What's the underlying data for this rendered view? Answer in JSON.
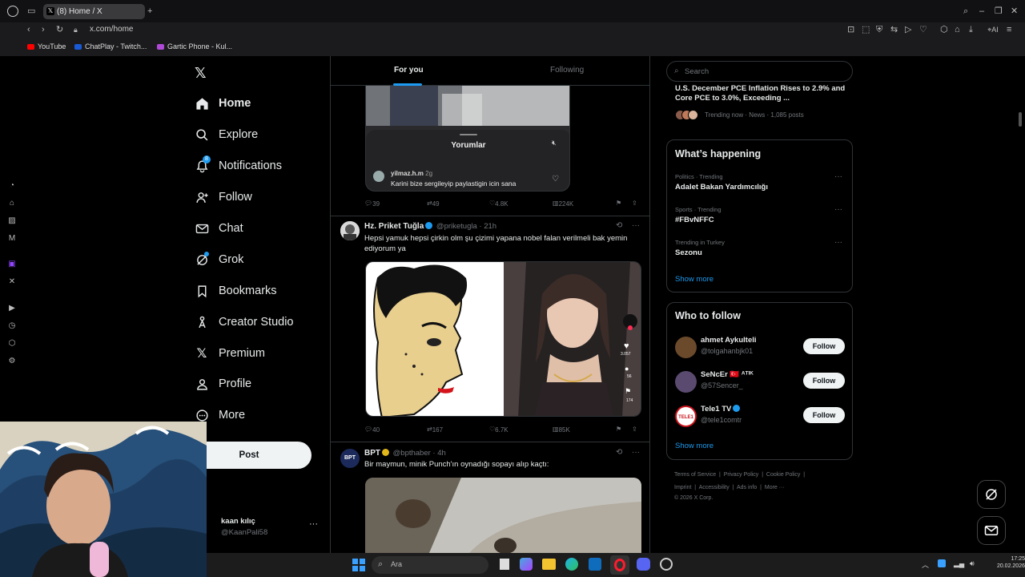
{
  "browser": {
    "tab_title": "(8) Home / X",
    "url": "x.com/home",
    "bookmarks": [
      {
        "label": "YouTube",
        "color": "#ff0000"
      },
      {
        "label": "ChatPlay - Twitch...",
        "color": "#1a5ad6"
      },
      {
        "label": "Gartic Phone - Kul...",
        "color": "#b04ad6"
      }
    ]
  },
  "nav": {
    "items": [
      {
        "label": "Home",
        "icon": "home-icon"
      },
      {
        "label": "Explore",
        "icon": "search-icon"
      },
      {
        "label": "Notifications",
        "icon": "bell-icon",
        "badge": "8"
      },
      {
        "label": "Follow",
        "icon": "person-plus-icon"
      },
      {
        "label": "Chat",
        "icon": "envelope-icon"
      },
      {
        "label": "Grok",
        "icon": "grok-icon"
      },
      {
        "label": "Bookmarks",
        "icon": "bookmark-icon"
      },
      {
        "label": "Creator Studio",
        "icon": "creator-icon"
      },
      {
        "label": "Premium",
        "icon": "x-icon"
      },
      {
        "label": "Profile",
        "icon": "person-icon"
      },
      {
        "label": "More",
        "icon": "more-circle-icon"
      }
    ],
    "post_label": "Post",
    "account": {
      "name": "kaan kılıç",
      "handle": "@KaanPali58"
    }
  },
  "feed": {
    "tabs": [
      "For you",
      "Following"
    ],
    "comments_overlay": {
      "title": "Yorumlar",
      "commenter": "yilmaz.h.m",
      "time": "2g",
      "text": "Karini bize sergileyip paylastigin icin sana"
    },
    "tweet1_actions": {
      "replies": "39",
      "reposts": "49",
      "likes": "4.8K",
      "views": "224K"
    },
    "tweet2": {
      "name": "Hz. Priket Tuğla",
      "handle": "@priketugla",
      "time": "21h",
      "text": "Hepsi yamuk hepsi çirkin olm şu çizimi yapana nobel falan verilmeli bak yemin ediyorum ya",
      "side_counts": [
        "3.057",
        "56",
        "174"
      ],
      "actions": {
        "replies": "40",
        "reposts": "167",
        "likes": "6.7K",
        "views": "85K"
      }
    },
    "tweet3": {
      "avatar_text": "BPT",
      "name": "BPT",
      "handle": "@bpthaber",
      "time": "4h",
      "text": "Bir maymun, minik Punch'ın oynadığı sopayı alıp kaçtı:"
    }
  },
  "sidebar": {
    "search_placeholder": "Search",
    "top_trend": {
      "title": "U.S. December PCE Inflation Rises to 2.9% and Core PCE to 3.0%, Exceeding ...",
      "meta": "Trending now · News · 1,085 posts"
    },
    "happening": {
      "title": "What’s happening",
      "trends": [
        {
          "meta": "Politics · Trending",
          "title": "Adalet Bakan Yardımcılığı"
        },
        {
          "meta": "Sports · Trending",
          "title": "#FBvNFFC"
        },
        {
          "meta": "Trending in Turkey",
          "title": "Sezonu"
        }
      ],
      "show_more": "Show more"
    },
    "who_to_follow": {
      "title": "Who to follow",
      "accounts": [
        {
          "name": "ahmet Aykulteli",
          "handle": "@tolgahanbjk01",
          "avatar_color": "#6b4a2b"
        },
        {
          "name": "SeNcEr 🇹🇷 ᴬᵀᴵᴷ",
          "handle": "@57Sencer_",
          "avatar_color": "#5a4a70"
        },
        {
          "name": "Tele1 TV",
          "handle": "@tele1comtr",
          "avatar_color": "#c9141c"
        }
      ],
      "follow_label": "Follow",
      "show_more": "Show more"
    },
    "footer_links": [
      "Terms of Service",
      "Privacy Policy",
      "Cookie Policy",
      "Imprint",
      "Accessibility",
      "Ads info",
      "More ···"
    ],
    "copyright": "© 2026 X Corp."
  },
  "taskbar": {
    "search_placeholder": "Ara",
    "time": "17:25",
    "date": "20.02.2026"
  }
}
